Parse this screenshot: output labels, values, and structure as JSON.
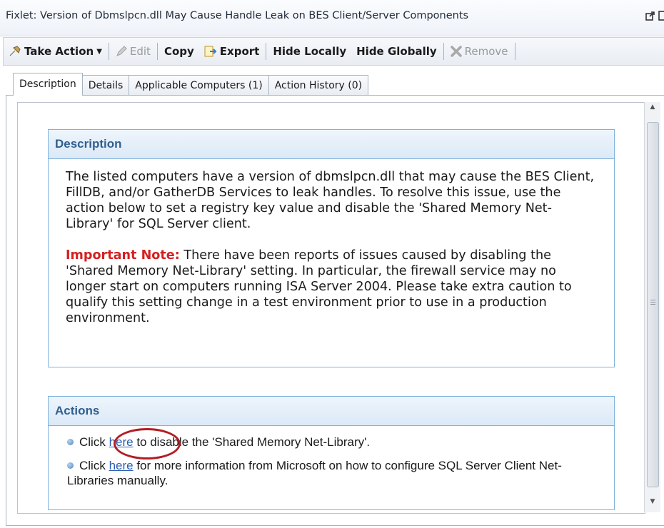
{
  "window": {
    "title": "Fixlet: Version of Dbmslpcn.dll May Cause Handle Leak on BES Client/Server Components"
  },
  "toolbar": {
    "take_action": "Take Action",
    "edit": "Edit",
    "copy": "Copy",
    "export": "Export",
    "hide_locally": "Hide Locally",
    "hide_globally": "Hide Globally",
    "remove": "Remove"
  },
  "tabs": [
    {
      "label": "Description",
      "active": true
    },
    {
      "label": "Details"
    },
    {
      "label": "Applicable Computers (1)"
    },
    {
      "label": "Action History (0)"
    }
  ],
  "description": {
    "heading": "Description",
    "paragraph": "The listed computers have a version of dbmslpcn.dll that may cause the BES Client, FillDB, and/or GatherDB Services to leak handles. To resolve this issue, use the action below to set a registry key value and disable the 'Shared Memory Net-Library' for SQL Server client.",
    "important_label": "Important Note:",
    "important_text": " There have been reports of issues caused by disabling the 'Shared Memory Net-Library' setting. In particular, the firewall service may no longer start on computers running ISA Server 2004. Please take extra caution to qualify this setting change in a test environment prior to use in a production environment."
  },
  "actions": {
    "heading": "Actions",
    "items": [
      {
        "prefix": "Click ",
        "link": "here",
        "suffix": " to disable the 'Shared Memory Net-Library'."
      },
      {
        "prefix": "Click ",
        "link": "here",
        "suffix": " for more information from Microsoft on how to configure SQL Server Client Net-Libraries manually."
      }
    ]
  },
  "colors": {
    "accent_blue": "#2f5f8f",
    "important_red": "#d42020",
    "link_blue": "#2a5db0",
    "annotation_circle": "#b21d24"
  }
}
